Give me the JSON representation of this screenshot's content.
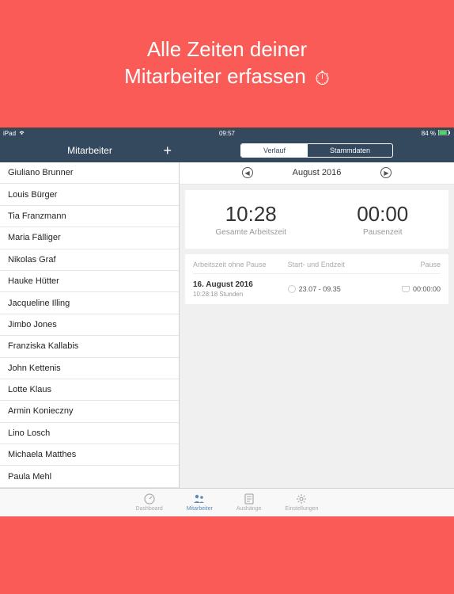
{
  "hero": {
    "line1": "Alle Zeiten deiner",
    "line2": "Mitarbeiter erfassen"
  },
  "status": {
    "device": "iPad",
    "time": "09:57",
    "battery": "84 %"
  },
  "sidebar": {
    "title": "Mitarbeiter",
    "employees": [
      "Giuliano Brunner",
      "Louis Bürger",
      "Tia Franzmann",
      "Maria Fälliger",
      "Nikolas Graf",
      "Hauke Hütter",
      "Jacqueline Illing",
      "Jimbo Jones",
      "Franziska Kallabis",
      "John Kettenis",
      "Lotte Klaus",
      "Armin Konieczny",
      "Lino Losch",
      "Michaela Matthes",
      "Paula Mehl"
    ]
  },
  "segmented": {
    "verlauf": "Verlauf",
    "stammdaten": "Stammdaten"
  },
  "month": "August 2016",
  "summary": {
    "worktime": "10:28",
    "worktime_label": "Gesamte Arbeitszeit",
    "pause": "00:00",
    "pause_label": "Pausenzeit"
  },
  "table": {
    "col_a": "Arbeitszeit ohne Pause",
    "col_b": "Start- und Endzeit",
    "col_c": "Pause",
    "row": {
      "date": "16. August 2016",
      "hours": "10:28:18 Stunden",
      "range": "23.07 - 09.35",
      "pause": "00:00:00"
    }
  },
  "tabs": {
    "dashboard": "Dashboard",
    "mitarbeiter": "Mitarbeiter",
    "aushange": "Aushänge",
    "einstellungen": "Einstellungen"
  }
}
